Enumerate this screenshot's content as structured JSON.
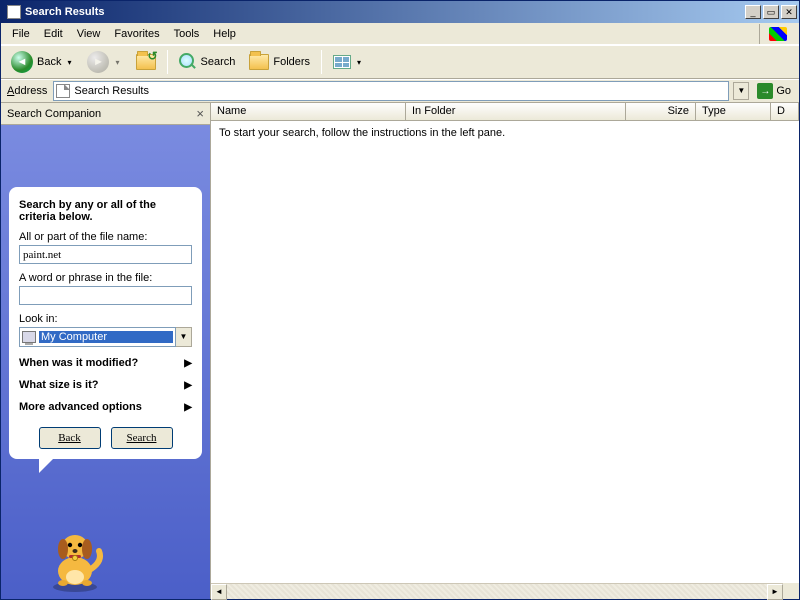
{
  "window": {
    "title": "Search Results"
  },
  "menu": {
    "file": "File",
    "edit": "Edit",
    "view": "View",
    "favorites": "Favorites",
    "tools": "Tools",
    "help": "Help"
  },
  "toolbar": {
    "back": "Back",
    "search": "Search",
    "folders": "Folders"
  },
  "address": {
    "label": "Address",
    "value": "Search Results",
    "go": "Go"
  },
  "side": {
    "header": "Search Companion",
    "heading": "Search by any or all of the criteria below.",
    "filename_label": "All or part of the file name:",
    "filename_value": "paint.net",
    "phrase_label": "A word or phrase in the file:",
    "phrase_value": "",
    "lookin_label": "Look in:",
    "lookin_value": "My Computer",
    "exp_modified": "When was it modified?",
    "exp_size": "What size is it?",
    "exp_advanced": "More advanced options",
    "btn_back": "Back",
    "btn_search": "Search"
  },
  "columns": {
    "name": "Name",
    "folder": "In Folder",
    "size": "Size",
    "type": "Type",
    "last": "D"
  },
  "content": {
    "hint": "To start your search, follow the instructions in the left pane."
  }
}
